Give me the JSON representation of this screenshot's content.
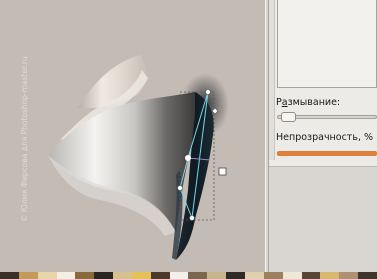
{
  "canvas": {
    "watermark": "© Юлия Фирсова для Photoshop-master.ru",
    "background": "#c5bbb5"
  },
  "panel": {
    "blur_label_prefix": "Р",
    "blur_label_mnemonic": "а",
    "blur_label_rest": "змывание:",
    "blur_value": 0.05,
    "opacity_label": "Непрозрачность, %",
    "opacity_value": 1.0,
    "accent_color": "#e07f3e"
  },
  "palette": {
    "swatches": [
      "#3a3028",
      "#c49a5a",
      "#e8d6a8",
      "#f4efe3",
      "#8a6a3c",
      "#2a2520",
      "#d6c090",
      "#e6c15a",
      "#4b3a2c",
      "#f2f0ea",
      "#7c6650",
      "#c8b48c",
      "#2f2a26",
      "#e0d0b0",
      "#9c8060",
      "#efe8d8",
      "#5a4636",
      "#d8b870",
      "#b09070",
      "#3e342c"
    ]
  }
}
